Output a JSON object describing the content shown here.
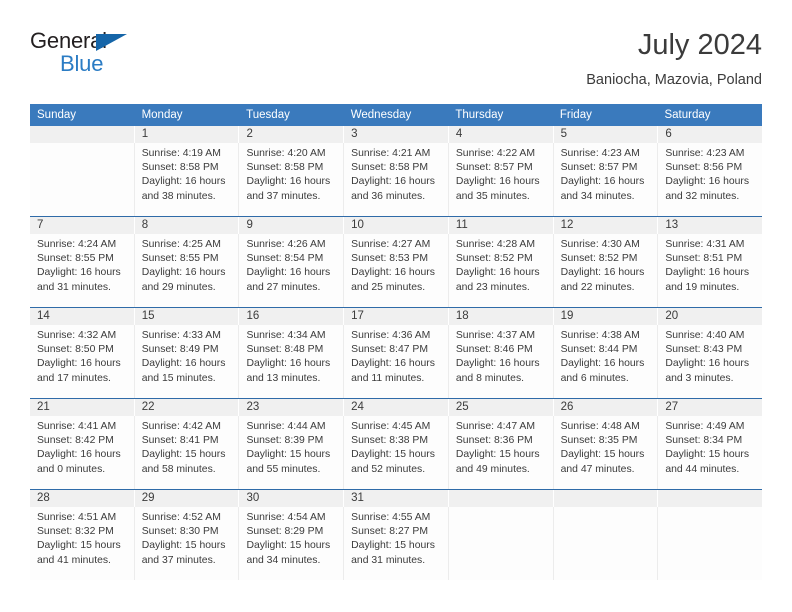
{
  "brand": {
    "name_part1": "General",
    "name_part2": "Blue",
    "triangle_color": "#1565a8",
    "blue_color": "#2b7cc4"
  },
  "header": {
    "title": "July 2024",
    "subtitle": "Baniocha, Mazovia, Poland"
  },
  "theme": {
    "header_blue": "#3a7abd",
    "row_divider_blue": "#2f6ba8",
    "date_strip_gray": "#f0f0f0",
    "text_color": "#3b3b3b"
  },
  "weekdays": [
    "Sunday",
    "Monday",
    "Tuesday",
    "Wednesday",
    "Thursday",
    "Friday",
    "Saturday"
  ],
  "weeks": [
    {
      "days": [
        {
          "date": "",
          "lines": [
            "",
            "",
            "",
            ""
          ]
        },
        {
          "date": "1",
          "lines": [
            "Sunrise: 4:19 AM",
            "Sunset: 8:58 PM",
            "Daylight: 16 hours",
            "and 38 minutes."
          ]
        },
        {
          "date": "2",
          "lines": [
            "Sunrise: 4:20 AM",
            "Sunset: 8:58 PM",
            "Daylight: 16 hours",
            "and 37 minutes."
          ]
        },
        {
          "date": "3",
          "lines": [
            "Sunrise: 4:21 AM",
            "Sunset: 8:58 PM",
            "Daylight: 16 hours",
            "and 36 minutes."
          ]
        },
        {
          "date": "4",
          "lines": [
            "Sunrise: 4:22 AM",
            "Sunset: 8:57 PM",
            "Daylight: 16 hours",
            "and 35 minutes."
          ]
        },
        {
          "date": "5",
          "lines": [
            "Sunrise: 4:23 AM",
            "Sunset: 8:57 PM",
            "Daylight: 16 hours",
            "and 34 minutes."
          ]
        },
        {
          "date": "6",
          "lines": [
            "Sunrise: 4:23 AM",
            "Sunset: 8:56 PM",
            "Daylight: 16 hours",
            "and 32 minutes."
          ]
        }
      ]
    },
    {
      "days": [
        {
          "date": "7",
          "lines": [
            "Sunrise: 4:24 AM",
            "Sunset: 8:55 PM",
            "Daylight: 16 hours",
            "and 31 minutes."
          ]
        },
        {
          "date": "8",
          "lines": [
            "Sunrise: 4:25 AM",
            "Sunset: 8:55 PM",
            "Daylight: 16 hours",
            "and 29 minutes."
          ]
        },
        {
          "date": "9",
          "lines": [
            "Sunrise: 4:26 AM",
            "Sunset: 8:54 PM",
            "Daylight: 16 hours",
            "and 27 minutes."
          ]
        },
        {
          "date": "10",
          "lines": [
            "Sunrise: 4:27 AM",
            "Sunset: 8:53 PM",
            "Daylight: 16 hours",
            "and 25 minutes."
          ]
        },
        {
          "date": "11",
          "lines": [
            "Sunrise: 4:28 AM",
            "Sunset: 8:52 PM",
            "Daylight: 16 hours",
            "and 23 minutes."
          ]
        },
        {
          "date": "12",
          "lines": [
            "Sunrise: 4:30 AM",
            "Sunset: 8:52 PM",
            "Daylight: 16 hours",
            "and 22 minutes."
          ]
        },
        {
          "date": "13",
          "lines": [
            "Sunrise: 4:31 AM",
            "Sunset: 8:51 PM",
            "Daylight: 16 hours",
            "and 19 minutes."
          ]
        }
      ]
    },
    {
      "days": [
        {
          "date": "14",
          "lines": [
            "Sunrise: 4:32 AM",
            "Sunset: 8:50 PM",
            "Daylight: 16 hours",
            "and 17 minutes."
          ]
        },
        {
          "date": "15",
          "lines": [
            "Sunrise: 4:33 AM",
            "Sunset: 8:49 PM",
            "Daylight: 16 hours",
            "and 15 minutes."
          ]
        },
        {
          "date": "16",
          "lines": [
            "Sunrise: 4:34 AM",
            "Sunset: 8:48 PM",
            "Daylight: 16 hours",
            "and 13 minutes."
          ]
        },
        {
          "date": "17",
          "lines": [
            "Sunrise: 4:36 AM",
            "Sunset: 8:47 PM",
            "Daylight: 16 hours",
            "and 11 minutes."
          ]
        },
        {
          "date": "18",
          "lines": [
            "Sunrise: 4:37 AM",
            "Sunset: 8:46 PM",
            "Daylight: 16 hours",
            "and 8 minutes."
          ]
        },
        {
          "date": "19",
          "lines": [
            "Sunrise: 4:38 AM",
            "Sunset: 8:44 PM",
            "Daylight: 16 hours",
            "and 6 minutes."
          ]
        },
        {
          "date": "20",
          "lines": [
            "Sunrise: 4:40 AM",
            "Sunset: 8:43 PM",
            "Daylight: 16 hours",
            "and 3 minutes."
          ]
        }
      ]
    },
    {
      "days": [
        {
          "date": "21",
          "lines": [
            "Sunrise: 4:41 AM",
            "Sunset: 8:42 PM",
            "Daylight: 16 hours",
            "and 0 minutes."
          ]
        },
        {
          "date": "22",
          "lines": [
            "Sunrise: 4:42 AM",
            "Sunset: 8:41 PM",
            "Daylight: 15 hours",
            "and 58 minutes."
          ]
        },
        {
          "date": "23",
          "lines": [
            "Sunrise: 4:44 AM",
            "Sunset: 8:39 PM",
            "Daylight: 15 hours",
            "and 55 minutes."
          ]
        },
        {
          "date": "24",
          "lines": [
            "Sunrise: 4:45 AM",
            "Sunset: 8:38 PM",
            "Daylight: 15 hours",
            "and 52 minutes."
          ]
        },
        {
          "date": "25",
          "lines": [
            "Sunrise: 4:47 AM",
            "Sunset: 8:36 PM",
            "Daylight: 15 hours",
            "and 49 minutes."
          ]
        },
        {
          "date": "26",
          "lines": [
            "Sunrise: 4:48 AM",
            "Sunset: 8:35 PM",
            "Daylight: 15 hours",
            "and 47 minutes."
          ]
        },
        {
          "date": "27",
          "lines": [
            "Sunrise: 4:49 AM",
            "Sunset: 8:34 PM",
            "Daylight: 15 hours",
            "and 44 minutes."
          ]
        }
      ]
    },
    {
      "days": [
        {
          "date": "28",
          "lines": [
            "Sunrise: 4:51 AM",
            "Sunset: 8:32 PM",
            "Daylight: 15 hours",
            "and 41 minutes."
          ]
        },
        {
          "date": "29",
          "lines": [
            "Sunrise: 4:52 AM",
            "Sunset: 8:30 PM",
            "Daylight: 15 hours",
            "and 37 minutes."
          ]
        },
        {
          "date": "30",
          "lines": [
            "Sunrise: 4:54 AM",
            "Sunset: 8:29 PM",
            "Daylight: 15 hours",
            "and 34 minutes."
          ]
        },
        {
          "date": "31",
          "lines": [
            "Sunrise: 4:55 AM",
            "Sunset: 8:27 PM",
            "Daylight: 15 hours",
            "and 31 minutes."
          ]
        },
        {
          "date": "",
          "lines": [
            "",
            "",
            "",
            ""
          ]
        },
        {
          "date": "",
          "lines": [
            "",
            "",
            "",
            ""
          ]
        },
        {
          "date": "",
          "lines": [
            "",
            "",
            "",
            ""
          ]
        }
      ]
    }
  ]
}
